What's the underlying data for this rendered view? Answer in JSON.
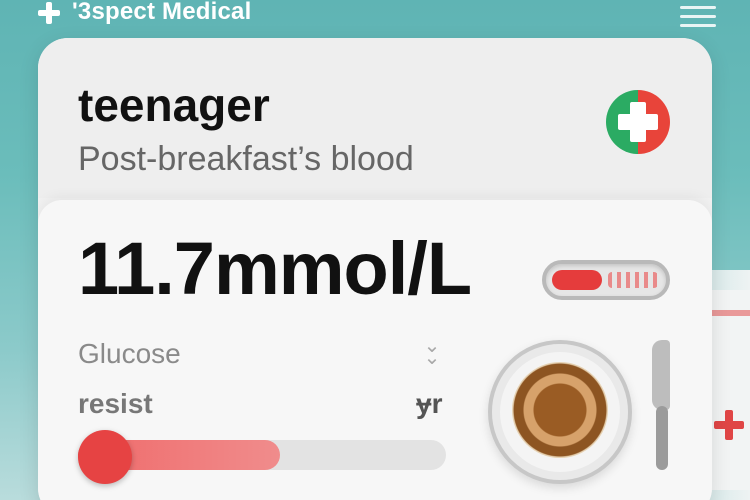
{
  "header": {
    "brand": "'3spect Medical",
    "menu_icon": "hamburger-menu-icon"
  },
  "card": {
    "title": "teenager",
    "subtitle": "Post-breakfast’s blood",
    "badge_icon": "medical-cross-icon",
    "reading": "11.7mmol/L",
    "reading_level_fraction": 0.45,
    "label_glucose": "Glucose",
    "label_resist": "resist",
    "label_unit": "ɏr",
    "progress_fraction": 0.55,
    "meal_icon": "plate-pancake-icon",
    "knife_icon": "knife-icon"
  },
  "colors": {
    "background_teal": "#6bbdbb",
    "card": "#f1f1f1",
    "accent_red": "#e64343",
    "badge_green": "#2bab63"
  }
}
